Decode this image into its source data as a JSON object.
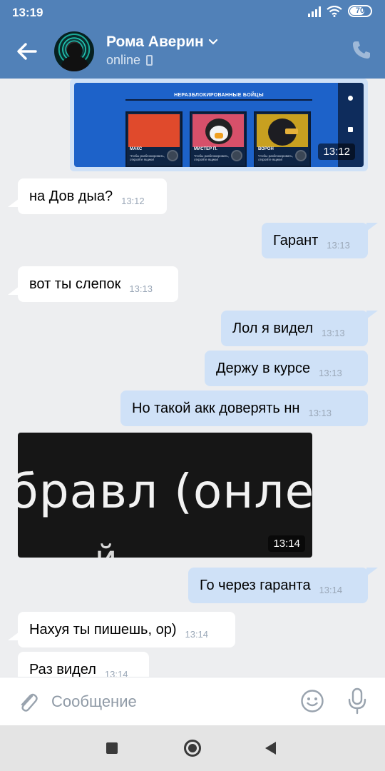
{
  "status_bar": {
    "time": "13:19",
    "battery": "70"
  },
  "header": {
    "contact_name": "Рома Аверин",
    "status": "online"
  },
  "top_image": {
    "title": "НЕРАЗБЛОКИРОВАННЫЕ БОЙЦЫ",
    "cards": [
      {
        "name": "МАКС",
        "desc": "Чтобы разблокировать, откройте ящики!"
      },
      {
        "name": "МИСТЕР П.",
        "desc": "Чтобы разблокировать, откройте ящики!"
      },
      {
        "name": "ВОРОН",
        "desc": "Чтобы разблокировать, откройте ящики!"
      }
    ],
    "time": "13:12"
  },
  "messages": [
    {
      "text": "на Дов дыа?",
      "time": "13:12"
    },
    {
      "text": "Гарант",
      "time": "13:13"
    },
    {
      "text": "вот ты слепок",
      "time": "13:13"
    },
    {
      "text": "Лол я видел",
      "time": "13:13"
    },
    {
      "text": "Держу в курсе",
      "time": "13:13"
    },
    {
      "text": "Но такой акк доверять нн",
      "time": "13:13"
    },
    {
      "text": "Го через гаранта",
      "time": "13:14"
    },
    {
      "text": "Нахуя ты пишешь, ор)",
      "time": "13:14"
    },
    {
      "text": "Раз видел",
      "time": "13:14"
    }
  ],
  "dark_image": {
    "text": "бравл (онле",
    "bottom_text": "й",
    "time": "13:14"
  },
  "input": {
    "placeholder": "Сообщение"
  }
}
